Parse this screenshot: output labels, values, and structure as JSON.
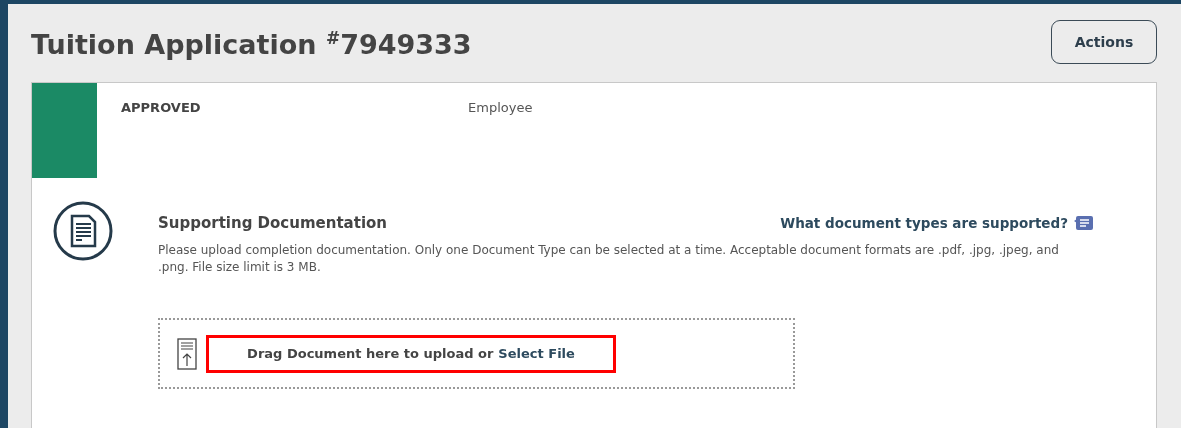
{
  "page": {
    "title": "Tuition Application $^{#}$7949333",
    "actions_button": "Actions"
  },
  "summary": {
    "status": "APPROVED",
    "color": "#1b8a65",
    "role": "Employee"
  },
  "documentation": {
    "heading": "Supporting Documentation",
    "help_link": "What document types are supported?",
    "description": "Please upload completion documentation. Only one Document Type can be selected at a time. Acceptable document formats are .pdf, .jpg, .jpeg, and .png. File size limit is 3 MB.",
    "dropzone": {
      "prompt": "Drag Document here to upload or",
      "link": "Select File",
      "highlighted": true
    }
  }
}
